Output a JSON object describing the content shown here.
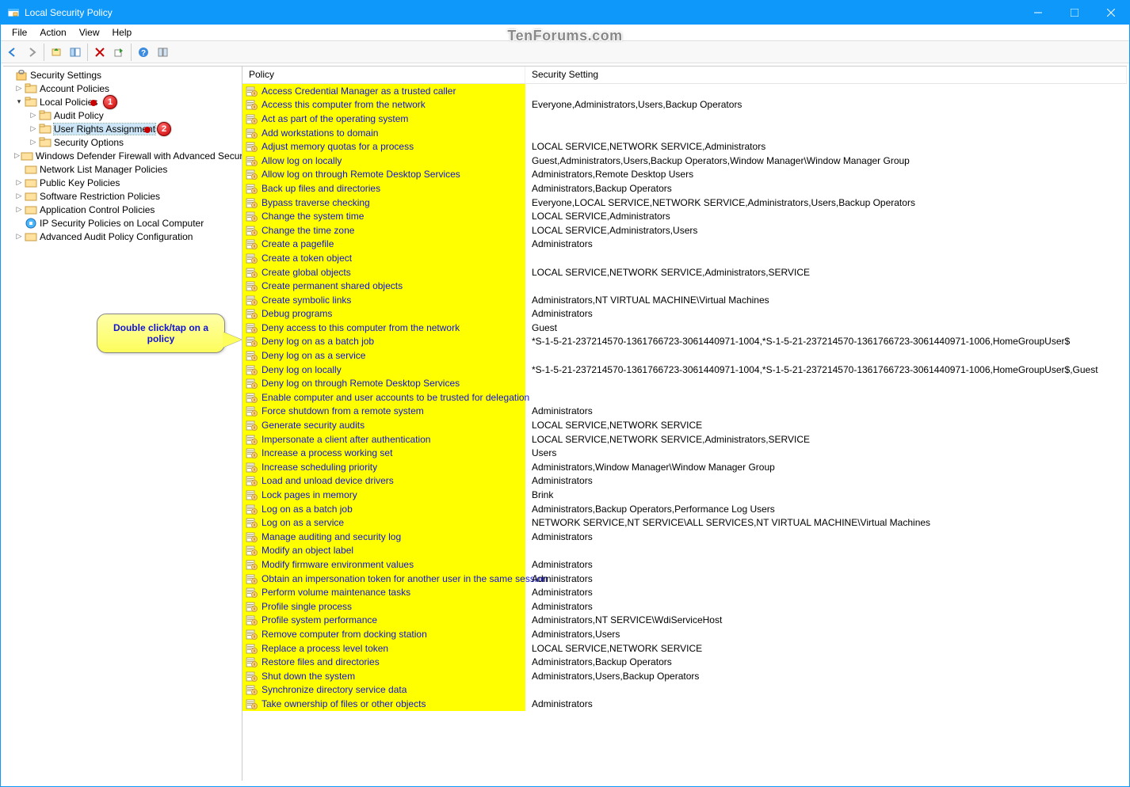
{
  "window": {
    "title": "Local Security Policy"
  },
  "menu": [
    "File",
    "Action",
    "View",
    "Help"
  ],
  "watermark": "TenForums.com",
  "badges": {
    "one": "1",
    "two": "2"
  },
  "tree": {
    "root": "Security Settings",
    "n0": "Account Policies",
    "n1": "Local Policies",
    "n1a": "Audit Policy",
    "n1b": "User Rights Assignment",
    "n1c": "Security Options",
    "n2": "Windows Defender Firewall with Advanced Security",
    "n3": "Network List Manager Policies",
    "n4": "Public Key Policies",
    "n5": "Software Restriction Policies",
    "n6": "Application Control Policies",
    "n7": "IP Security Policies on Local Computer",
    "n8": "Advanced Audit Policy Configuration"
  },
  "callout": "Double click/tap on a policy",
  "columns": {
    "policy": "Policy",
    "setting": "Security Setting"
  },
  "policies": [
    {
      "name": "Access Credential Manager as a trusted caller",
      "setting": ""
    },
    {
      "name": "Access this computer from the network",
      "setting": "Everyone,Administrators,Users,Backup Operators"
    },
    {
      "name": "Act as part of the operating system",
      "setting": ""
    },
    {
      "name": "Add workstations to domain",
      "setting": ""
    },
    {
      "name": "Adjust memory quotas for a process",
      "setting": "LOCAL SERVICE,NETWORK SERVICE,Administrators"
    },
    {
      "name": "Allow log on locally",
      "setting": "Guest,Administrators,Users,Backup Operators,Window Manager\\Window Manager Group"
    },
    {
      "name": "Allow log on through Remote Desktop Services",
      "setting": "Administrators,Remote Desktop Users"
    },
    {
      "name": "Back up files and directories",
      "setting": "Administrators,Backup Operators"
    },
    {
      "name": "Bypass traverse checking",
      "setting": "Everyone,LOCAL SERVICE,NETWORK SERVICE,Administrators,Users,Backup Operators"
    },
    {
      "name": "Change the system time",
      "setting": "LOCAL SERVICE,Administrators"
    },
    {
      "name": "Change the time zone",
      "setting": "LOCAL SERVICE,Administrators,Users"
    },
    {
      "name": "Create a pagefile",
      "setting": "Administrators"
    },
    {
      "name": "Create a token object",
      "setting": ""
    },
    {
      "name": "Create global objects",
      "setting": "LOCAL SERVICE,NETWORK SERVICE,Administrators,SERVICE"
    },
    {
      "name": "Create permanent shared objects",
      "setting": ""
    },
    {
      "name": "Create symbolic links",
      "setting": "Administrators,NT VIRTUAL MACHINE\\Virtual Machines"
    },
    {
      "name": "Debug programs",
      "setting": "Administrators"
    },
    {
      "name": "Deny access to this computer from the network",
      "setting": "Guest"
    },
    {
      "name": "Deny log on as a batch job",
      "setting": "*S-1-5-21-237214570-1361766723-3061440971-1004,*S-1-5-21-237214570-1361766723-3061440971-1006,HomeGroupUser$"
    },
    {
      "name": "Deny log on as a service",
      "setting": ""
    },
    {
      "name": "Deny log on locally",
      "setting": "*S-1-5-21-237214570-1361766723-3061440971-1004,*S-1-5-21-237214570-1361766723-3061440971-1006,HomeGroupUser$,Guest"
    },
    {
      "name": "Deny log on through Remote Desktop Services",
      "setting": ""
    },
    {
      "name": "Enable computer and user accounts to be trusted for delegation",
      "setting": ""
    },
    {
      "name": "Force shutdown from a remote system",
      "setting": "Administrators"
    },
    {
      "name": "Generate security audits",
      "setting": "LOCAL SERVICE,NETWORK SERVICE"
    },
    {
      "name": "Impersonate a client after authentication",
      "setting": "LOCAL SERVICE,NETWORK SERVICE,Administrators,SERVICE"
    },
    {
      "name": "Increase a process working set",
      "setting": "Users"
    },
    {
      "name": "Increase scheduling priority",
      "setting": "Administrators,Window Manager\\Window Manager Group"
    },
    {
      "name": "Load and unload device drivers",
      "setting": "Administrators"
    },
    {
      "name": "Lock pages in memory",
      "setting": "Brink"
    },
    {
      "name": "Log on as a batch job",
      "setting": "Administrators,Backup Operators,Performance Log Users"
    },
    {
      "name": "Log on as a service",
      "setting": "NETWORK SERVICE,NT SERVICE\\ALL SERVICES,NT VIRTUAL MACHINE\\Virtual Machines"
    },
    {
      "name": "Manage auditing and security log",
      "setting": "Administrators"
    },
    {
      "name": "Modify an object label",
      "setting": ""
    },
    {
      "name": "Modify firmware environment values",
      "setting": "Administrators"
    },
    {
      "name": "Obtain an impersonation token for another user in the same session",
      "setting": "Administrators"
    },
    {
      "name": "Perform volume maintenance tasks",
      "setting": "Administrators"
    },
    {
      "name": "Profile single process",
      "setting": "Administrators"
    },
    {
      "name": "Profile system performance",
      "setting": "Administrators,NT SERVICE\\WdiServiceHost"
    },
    {
      "name": "Remove computer from docking station",
      "setting": "Administrators,Users"
    },
    {
      "name": "Replace a process level token",
      "setting": "LOCAL SERVICE,NETWORK SERVICE"
    },
    {
      "name": "Restore files and directories",
      "setting": "Administrators,Backup Operators"
    },
    {
      "name": "Shut down the system",
      "setting": "Administrators,Users,Backup Operators"
    },
    {
      "name": "Synchronize directory service data",
      "setting": ""
    },
    {
      "name": "Take ownership of files or other objects",
      "setting": "Administrators"
    }
  ]
}
